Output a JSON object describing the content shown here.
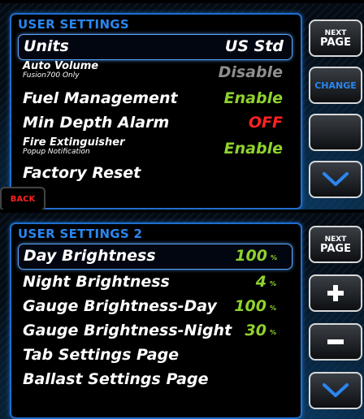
{
  "screen1": {
    "title": "USER SETTINGS",
    "rows": [
      {
        "label": "Units",
        "value": "US Std"
      },
      {
        "label": "Auto Volume",
        "sublabel": "Fusion700 Only",
        "value": "Disable"
      },
      {
        "label": "Fuel Management",
        "value": "Enable"
      },
      {
        "label": "Min Depth Alarm",
        "value": "OFF"
      },
      {
        "label": "Fire Extinguisher",
        "sublabel": "Popup Notification",
        "value": "Enable"
      },
      {
        "label": "Factory Reset"
      }
    ],
    "buttons": {
      "next_top": "NEXT",
      "next_bottom": "PAGE",
      "change": "CHANGE",
      "back": "BACK"
    }
  },
  "screen2": {
    "title": "USER SETTINGS 2",
    "rows": [
      {
        "label": "Day Brightness",
        "value": "100",
        "unit": "%"
      },
      {
        "label": "Night Brightness",
        "value": "4",
        "unit": "%"
      },
      {
        "label": "Gauge Brightness-Day",
        "value": "100",
        "unit": "%"
      },
      {
        "label": "Gauge Brightness-Night",
        "value": "30",
        "unit": "%"
      },
      {
        "label": "Tab Settings Page"
      },
      {
        "label": "Ballast Settings Page"
      }
    ],
    "buttons": {
      "next_top": "NEXT",
      "next_bottom": "PAGE"
    }
  },
  "colors": {
    "accent_blue": "#2a86f0",
    "value_green": "#8fd22e",
    "alarm_red": "#ff2222",
    "disabled_gray": "#8e8e8e"
  },
  "icons": [
    "plus-icon",
    "minus-icon",
    "chevron-down-icon"
  ]
}
